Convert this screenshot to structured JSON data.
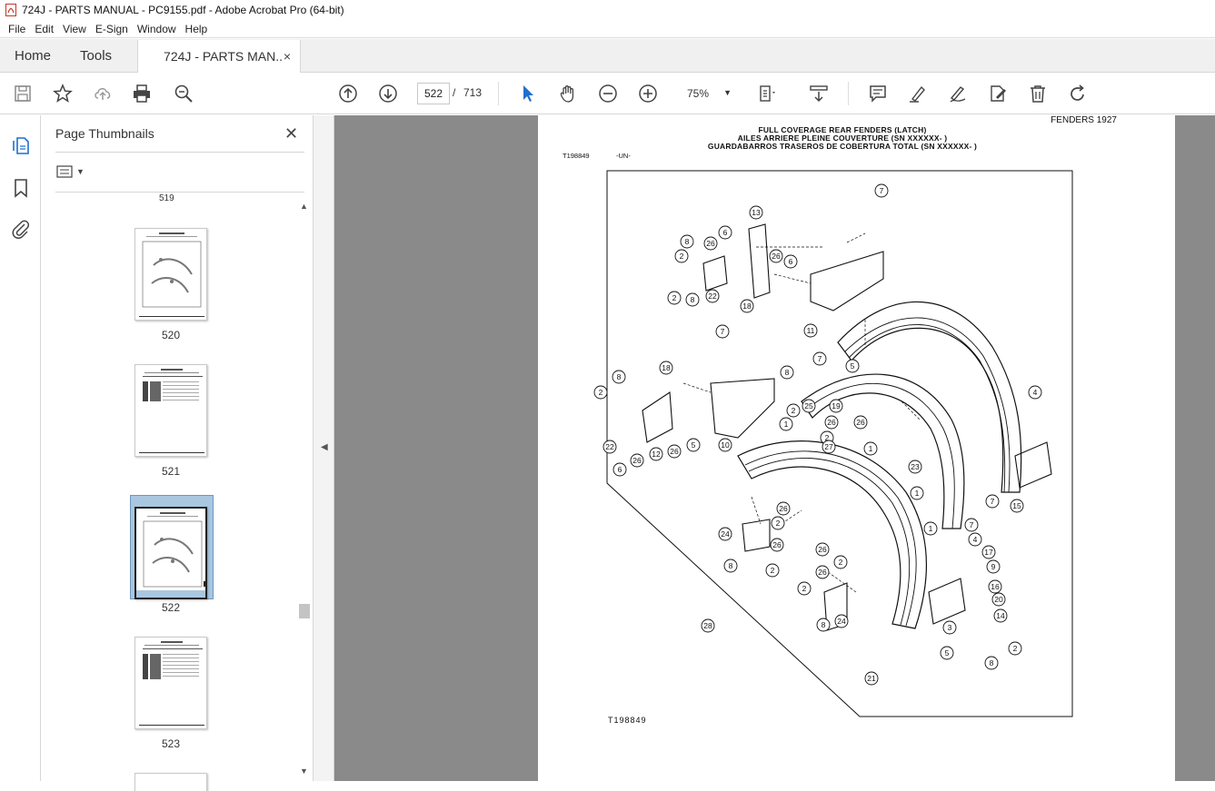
{
  "window": {
    "title": "724J - PARTS MANUAL - PC9155.pdf - Adobe Acrobat Pro (64-bit)"
  },
  "menu": [
    "File",
    "Edit",
    "View",
    "E-Sign",
    "Window",
    "Help"
  ],
  "tabs": {
    "home": "Home",
    "tools": "Tools",
    "document": "724J - PARTS MAN...",
    "close": "×"
  },
  "toolbar": {
    "current_page": "522",
    "separator": "/",
    "total_pages": "713",
    "zoom": "75%"
  },
  "thumbnails_panel": {
    "title": "Page Thumbnails",
    "close": "✕",
    "partial_label_top": "519",
    "items": [
      {
        "label": "520",
        "kind": "drawing"
      },
      {
        "label": "521",
        "kind": "table"
      },
      {
        "label": "522",
        "kind": "drawing",
        "selected": true
      },
      {
        "label": "523",
        "kind": "table"
      }
    ]
  },
  "document_page": {
    "header_right": "FENDERS 1927",
    "title_lines": [
      "FULL COVERAGE REAR FENDERS (LATCH)",
      "AILES ARRIERE PLEINE COUVERTURE (SN XXXXXX-      )",
      "GUARDABARROS TRASEROS DE COBERTURA TOTAL (SN XXXXXX-      )"
    ],
    "figure_ref": "T198849",
    "un_mark": "-UN-",
    "footer_ref": "T198849",
    "callouts": [
      "7",
      "13",
      "6",
      "8",
      "26",
      "2",
      "26",
      "6",
      "2",
      "8",
      "22",
      "18",
      "11",
      "7",
      "8",
      "18",
      "8",
      "7",
      "5",
      "2",
      "10",
      "12",
      "26",
      "5",
      "22",
      "6",
      "26",
      "2",
      "25",
      "19",
      "1",
      "26",
      "26",
      "2",
      "27",
      "1",
      "23",
      "4",
      "7",
      "15",
      "1",
      "26",
      "2",
      "24",
      "26",
      "8",
      "2",
      "1",
      "7",
      "4",
      "17",
      "9",
      "26",
      "2",
      "26",
      "16",
      "20",
      "2",
      "8",
      "24",
      "3",
      "14",
      "5",
      "2",
      "8",
      "21",
      "28"
    ]
  },
  "colors": {
    "accent_blue": "#2b6cb0",
    "selected_thumb": "#a9c7e0",
    "doc_background": "#8a8a8a"
  }
}
